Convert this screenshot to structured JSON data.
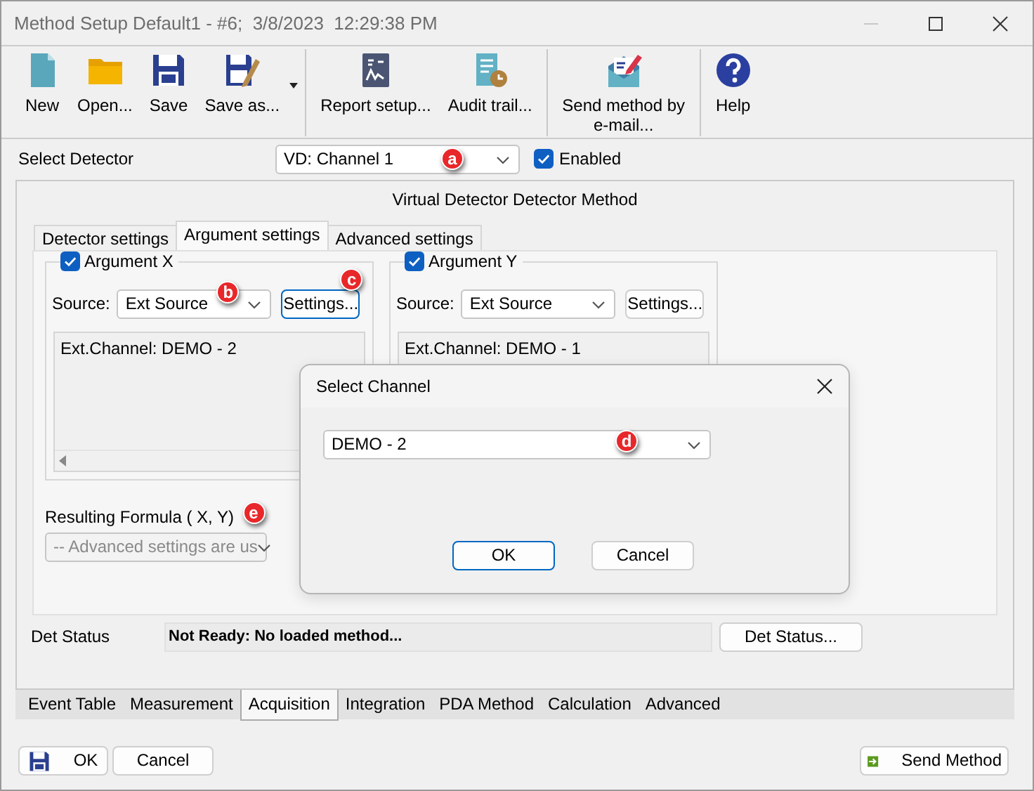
{
  "window": {
    "title": "Method Setup Default1 - #6;  3/8/2023  12:29:38 PM"
  },
  "toolbar": [
    {
      "buttons": [
        {
          "label": "New",
          "kind": "new"
        },
        {
          "label": "Open...",
          "kind": "open"
        },
        {
          "label": "Save",
          "kind": "save"
        },
        {
          "label": "Save as...",
          "kind": "saveas",
          "dropdown": true
        }
      ]
    },
    {
      "buttons": [
        {
          "label": "Report setup...",
          "kind": "report"
        },
        {
          "label": "Audit trail...",
          "kind": "audit"
        }
      ]
    },
    {
      "buttons": [
        {
          "label": "Send method by e-mail...",
          "kind": "mail"
        }
      ]
    },
    {
      "buttons": [
        {
          "label": "Help",
          "kind": "help"
        }
      ]
    }
  ],
  "detector": {
    "label": "Select Detector",
    "value": "VD: Channel 1",
    "marker": "a",
    "enabled": {
      "label": "Enabled",
      "checked": true
    }
  },
  "method_title": "Virtual Detector Detector Method",
  "inner_tabs": [
    {
      "label": "Detector settings",
      "selected": false
    },
    {
      "label": "Argument settings",
      "selected": true
    },
    {
      "label": "Advanced settings",
      "selected": false
    }
  ],
  "arguments": [
    {
      "label": "Argument X",
      "checked": true,
      "source_label": "Source:",
      "source": "Ext Source",
      "source_marker": "b",
      "settings": "Settings...",
      "settings_focused": true,
      "settings_marker": "c",
      "info": "Ext.Channel: DEMO - 2",
      "scrollbar": true
    },
    {
      "label": "Argument Y",
      "checked": true,
      "source_label": "Source:",
      "source": "Ext Source",
      "settings": "Settings...",
      "settings_focused": false,
      "info": "Ext.Channel: DEMO - 1"
    }
  ],
  "formula": {
    "label": "Resulting Formula ( X, Y)",
    "marker": "e",
    "value": "-- Advanced settings are us",
    "disabled": true
  },
  "det_status": {
    "label": "Det Status",
    "value": "Not Ready: No loaded method...",
    "button": "Det Status..."
  },
  "bottom_tabs": [
    {
      "label": "Event Table",
      "selected": false
    },
    {
      "label": "Measurement",
      "selected": false
    },
    {
      "label": "Acquisition",
      "selected": true
    },
    {
      "label": "Integration",
      "selected": false
    },
    {
      "label": "PDA Method",
      "selected": false
    },
    {
      "label": "Calculation",
      "selected": false
    },
    {
      "label": "Advanced",
      "selected": false
    }
  ],
  "footer": {
    "ok": "OK",
    "cancel": "Cancel",
    "send": "Send Method"
  },
  "dialog": {
    "title": "Select Channel",
    "value": "DEMO - 2",
    "marker": "d",
    "ok": "OK",
    "cancel": "Cancel"
  }
}
